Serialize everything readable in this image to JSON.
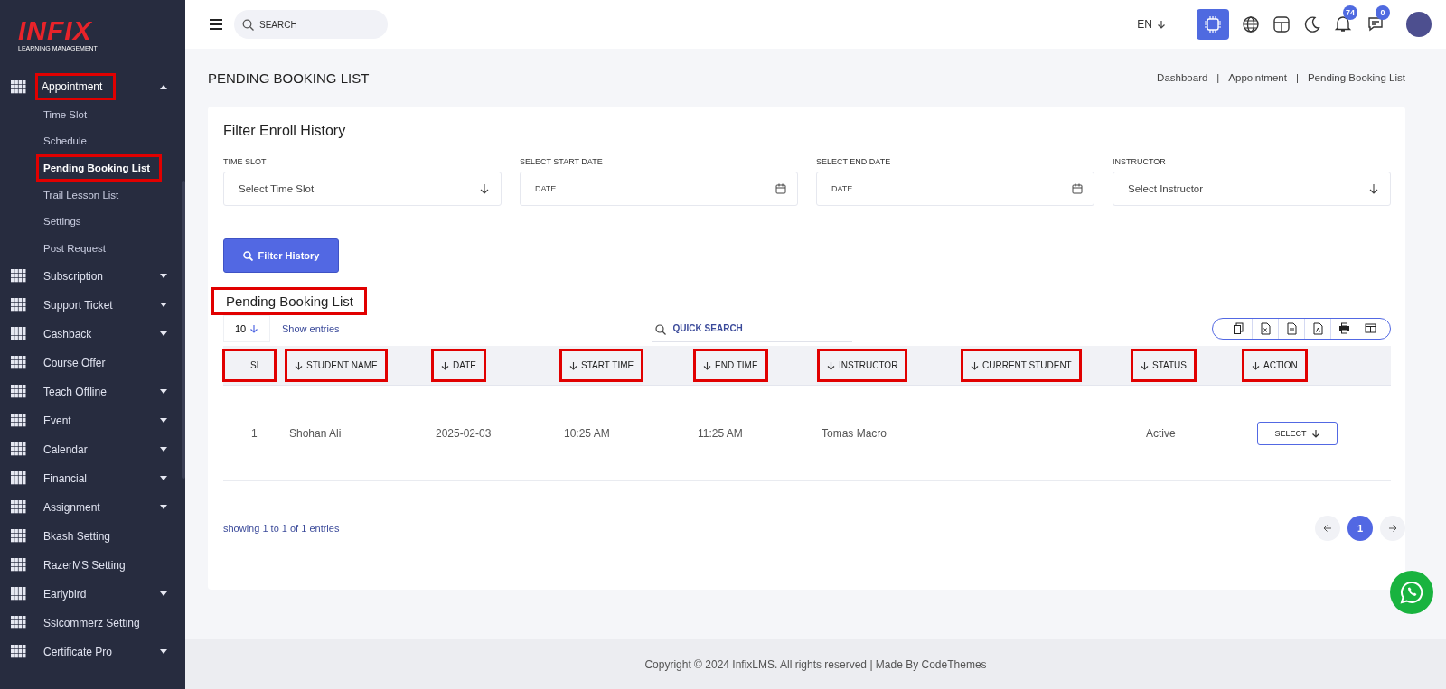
{
  "sidebar": {
    "logo": "INFIX",
    "logo_subtitle": "LEARNING MANAGEMENT",
    "items": [
      {
        "label": "Appointment",
        "kind": "menu",
        "expanded": true,
        "highlighted": true,
        "children": [
          {
            "label": "Time Slot",
            "selected": false,
            "highlighted": false
          },
          {
            "label": "Schedule",
            "selected": false,
            "highlighted": false
          },
          {
            "label": "Pending Booking List",
            "selected": true,
            "highlighted": true
          },
          {
            "label": "Trail Lesson List",
            "selected": false,
            "highlighted": false
          },
          {
            "label": "Settings",
            "selected": false,
            "highlighted": false
          },
          {
            "label": "Post Request",
            "selected": false,
            "highlighted": false
          }
        ]
      },
      {
        "label": "Subscription",
        "kind": "menu",
        "expanded": false,
        "highlighted": false
      },
      {
        "label": "Support Ticket",
        "kind": "menu",
        "expanded": false,
        "highlighted": false
      },
      {
        "label": "Cashback",
        "kind": "menu",
        "expanded": false,
        "highlighted": false
      },
      {
        "label": "Course Offer",
        "kind": "link",
        "highlighted": false
      },
      {
        "label": "Teach Offline",
        "kind": "menu",
        "expanded": false,
        "highlighted": false
      },
      {
        "label": "Event",
        "kind": "menu",
        "expanded": false,
        "highlighted": false
      },
      {
        "label": "Calendar",
        "kind": "menu",
        "expanded": false,
        "highlighted": false
      },
      {
        "label": "Financial",
        "kind": "menu",
        "expanded": false,
        "highlighted": false
      },
      {
        "label": "Assignment",
        "kind": "menu",
        "expanded": false,
        "highlighted": false
      },
      {
        "label": "Bkash Setting",
        "kind": "link",
        "highlighted": false
      },
      {
        "label": "RazerMS Setting",
        "kind": "link",
        "highlighted": false
      },
      {
        "label": "Earlybird",
        "kind": "menu",
        "expanded": false,
        "highlighted": false
      },
      {
        "label": "Sslcommerz Setting",
        "kind": "link",
        "highlighted": false
      },
      {
        "label": "Certificate Pro",
        "kind": "menu",
        "expanded": false,
        "highlighted": false
      }
    ]
  },
  "topbar": {
    "search": {
      "placeholder": "SEARCH"
    },
    "language": "EN",
    "notifications": "74",
    "messages": "0"
  },
  "page_title": "PENDING BOOKING LIST",
  "breadcrumbs": [
    "Dashboard",
    "Appointment",
    "Pending Booking List"
  ],
  "breadcrumb_separator": "|",
  "filter": {
    "title": "Filter Enroll History",
    "fields": [
      {
        "label": "TIME SLOT",
        "placeholder": "Select Time Slot",
        "kind": "select"
      },
      {
        "label": "SELECT START DATE",
        "placeholder": "DATE",
        "kind": "date"
      },
      {
        "label": "SELECT END DATE",
        "placeholder": "DATE",
        "kind": "date"
      },
      {
        "label": "INSTRUCTOR",
        "placeholder": "Select Instructor",
        "kind": "select"
      }
    ],
    "button": "Filter History"
  },
  "list": {
    "title": "Pending Booking List",
    "title_highlighted": true,
    "page_size": "10",
    "page_size_label": "Show entries",
    "search": {
      "placeholder": "QUICK SEARCH"
    },
    "columns": [
      {
        "label": "SL",
        "sortable": false,
        "highlighted": true
      },
      {
        "label": "STUDENT NAME",
        "sortable": true,
        "highlighted": true
      },
      {
        "label": "DATE",
        "sortable": true,
        "highlighted": true
      },
      {
        "label": "START TIME",
        "sortable": true,
        "highlighted": true
      },
      {
        "label": "END TIME",
        "sortable": true,
        "highlighted": true
      },
      {
        "label": "INSTRUCTOR",
        "sortable": true,
        "highlighted": true
      },
      {
        "label": "CURRENT STUDENT",
        "sortable": true,
        "highlighted": true
      },
      {
        "label": "STATUS",
        "sortable": true,
        "highlighted": true
      },
      {
        "label": "ACTION",
        "sortable": true,
        "highlighted": true
      }
    ],
    "rows": [
      {
        "sl": "1",
        "student_name": "Shohan Ali",
        "date": "2025-02-03",
        "start_time": "10:25 AM",
        "end_time": "11:25 AM",
        "instructor": "Tomas Macro",
        "status": "Active",
        "action": "SELECT"
      }
    ],
    "summary": "showing 1 to 1 of 1 entries",
    "pages": [
      {
        "label": "1",
        "selected": true
      }
    ]
  },
  "footer": "Copyright © 2024 InfixLMS. All rights reserved | Made By CodeThemes"
}
